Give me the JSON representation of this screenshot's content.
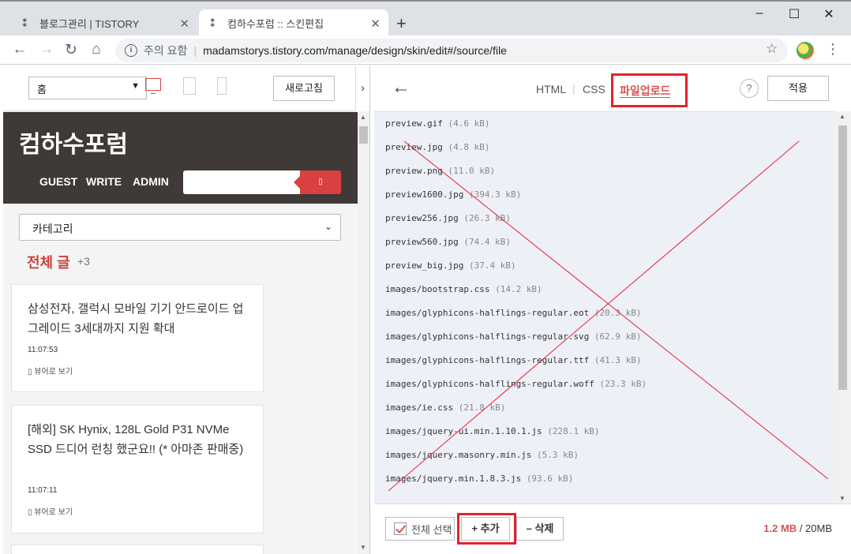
{
  "browser": {
    "tabs": [
      {
        "title": "블로그관리 | TISTORY"
      },
      {
        "title": "컴하수포럼 :: 스킨편집"
      }
    ],
    "new_tab": "+",
    "window_controls": {
      "minimize": "–",
      "maximize": "☐",
      "close": "✕"
    },
    "address": {
      "security_label": "주의 요함",
      "url": "madamstorys.tistory.com/manage/design/skin/edit#/source/file"
    },
    "icons": {
      "back": "arrow-left-icon",
      "forward": "arrow-right-icon",
      "reload": "reload-icon",
      "home": "home-icon",
      "bookmark": "star-icon",
      "menu": "menu-dots-icon"
    }
  },
  "preview": {
    "page_select": "홈",
    "refresh_label": "새로고침",
    "collapse_label": "›",
    "blog": {
      "title": "컴하수포럼",
      "nav": [
        "GUEST",
        "WRITE",
        "ADMIN"
      ],
      "search_icon": "search-icon"
    },
    "category_label": "카테고리",
    "all_posts_label": "전체 글",
    "all_posts_count": "+3",
    "posts": [
      {
        "title": "삼성전자, 갤럭시 모바일 기기 안드로이드 업그레이드 3세대까지 지원 확대",
        "time": "11:07:53",
        "view_label": "뷰어로 보기"
      },
      {
        "title": "[해외] SK Hynix, 128L Gold P31 NVMe SSD 드디어 런칭 했군요!! (* 아마존 판매중)",
        "time": "11:07:11",
        "view_label": "뷰어로 보기"
      }
    ]
  },
  "editor": {
    "tabs": [
      "HTML",
      "CSS",
      "파일업로드"
    ],
    "active_tab": "파일업로드",
    "help_label": "?",
    "apply_label": "적용",
    "files": [
      {
        "name": "preview.gif",
        "size": "(4.6 kB)"
      },
      {
        "name": "preview.jpg",
        "size": "(4.8 kB)"
      },
      {
        "name": "preview.png",
        "size": "(11.0 kB)"
      },
      {
        "name": "preview1600.jpg",
        "size": "(394.3 kB)"
      },
      {
        "name": "preview256.jpg",
        "size": "(26.3 kB)"
      },
      {
        "name": "preview560.jpg",
        "size": "(74.4 kB)"
      },
      {
        "name": "preview_big.jpg",
        "size": "(37.4 kB)"
      },
      {
        "name": "images/bootstrap.css",
        "size": "(14.2 kB)"
      },
      {
        "name": "images/glyphicons-halflings-regular.eot",
        "size": "(20.3 kB)"
      },
      {
        "name": "images/glyphicons-halflings-regular.svg",
        "size": "(62.9 kB)"
      },
      {
        "name": "images/glyphicons-halflings-regular.ttf",
        "size": "(41.3 kB)"
      },
      {
        "name": "images/glyphicons-halflings-regular.woff",
        "size": "(23.3 kB)"
      },
      {
        "name": "images/ie.css",
        "size": "(21.8 kB)"
      },
      {
        "name": "images/jquery-ui.min.1.10.1.js",
        "size": "(228.1 kB)"
      },
      {
        "name": "images/jquery.masonry.min.js",
        "size": "(5.3 kB)"
      },
      {
        "name": "images/jquery.min.1.8.3.js",
        "size": "(93.6 kB)"
      }
    ],
    "select_all_label": "전체 선택",
    "add_label": "+ 추가",
    "delete_label": "– 삭제",
    "usage_used": "1.2 MB",
    "usage_total": "/ 20MB",
    "highlight_color": "#e8202a",
    "accent_color": "#d9534f"
  }
}
